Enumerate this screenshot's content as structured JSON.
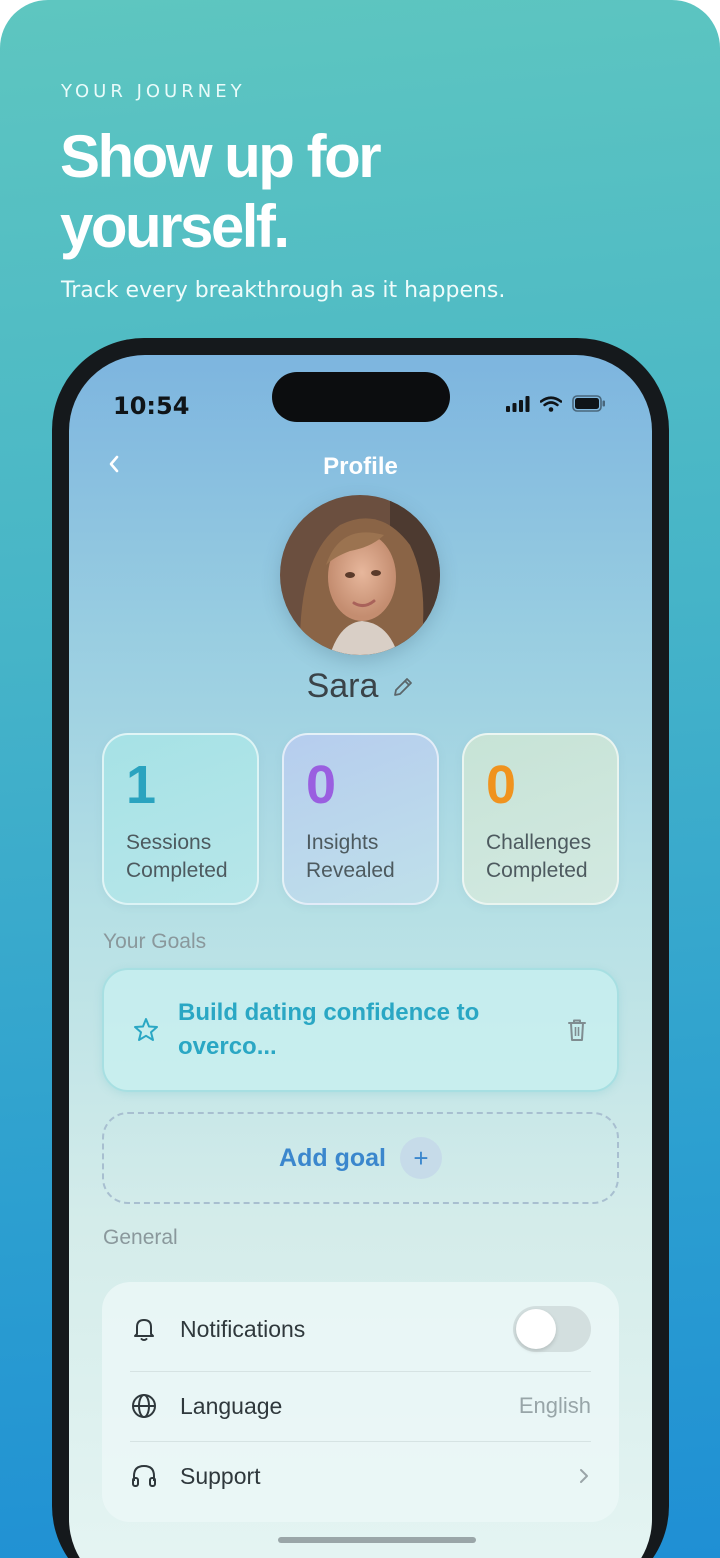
{
  "marketing": {
    "eyebrow": "YOUR JOURNEY",
    "headline": "Show up for yourself.",
    "subhead": "Track every breakthrough as it happens."
  },
  "status_bar": {
    "time": "10:54",
    "icons": [
      "signal-icon",
      "wifi-icon",
      "battery-icon"
    ]
  },
  "header": {
    "title": "Profile",
    "back_icon": "chevron-left-icon"
  },
  "profile": {
    "name": "Sara",
    "edit_icon": "pencil-icon"
  },
  "stats": [
    {
      "value": "1",
      "label": "Sessions Completed",
      "color": "#2aa3bf"
    },
    {
      "value": "0",
      "label": "Insights Revealed",
      "color": "#9a5fe0"
    },
    {
      "value": "0",
      "label": "Challenges Completed",
      "color": "#f0931e"
    }
  ],
  "goals": {
    "section_label": "Your Goals",
    "items": [
      {
        "text": "Build dating confidence to overco...",
        "icon": "star-icon",
        "action_icon": "trash-icon"
      }
    ],
    "add_label": "Add goal",
    "add_icon": "+"
  },
  "general": {
    "section_label": "General",
    "notifications": {
      "label": "Notifications",
      "icon": "bell-icon",
      "enabled": false
    },
    "language": {
      "label": "Language",
      "icon": "globe-icon",
      "value": "English"
    },
    "support": {
      "label": "Support",
      "icon": "headphones-icon",
      "chevron": "chevron-right-icon"
    }
  }
}
